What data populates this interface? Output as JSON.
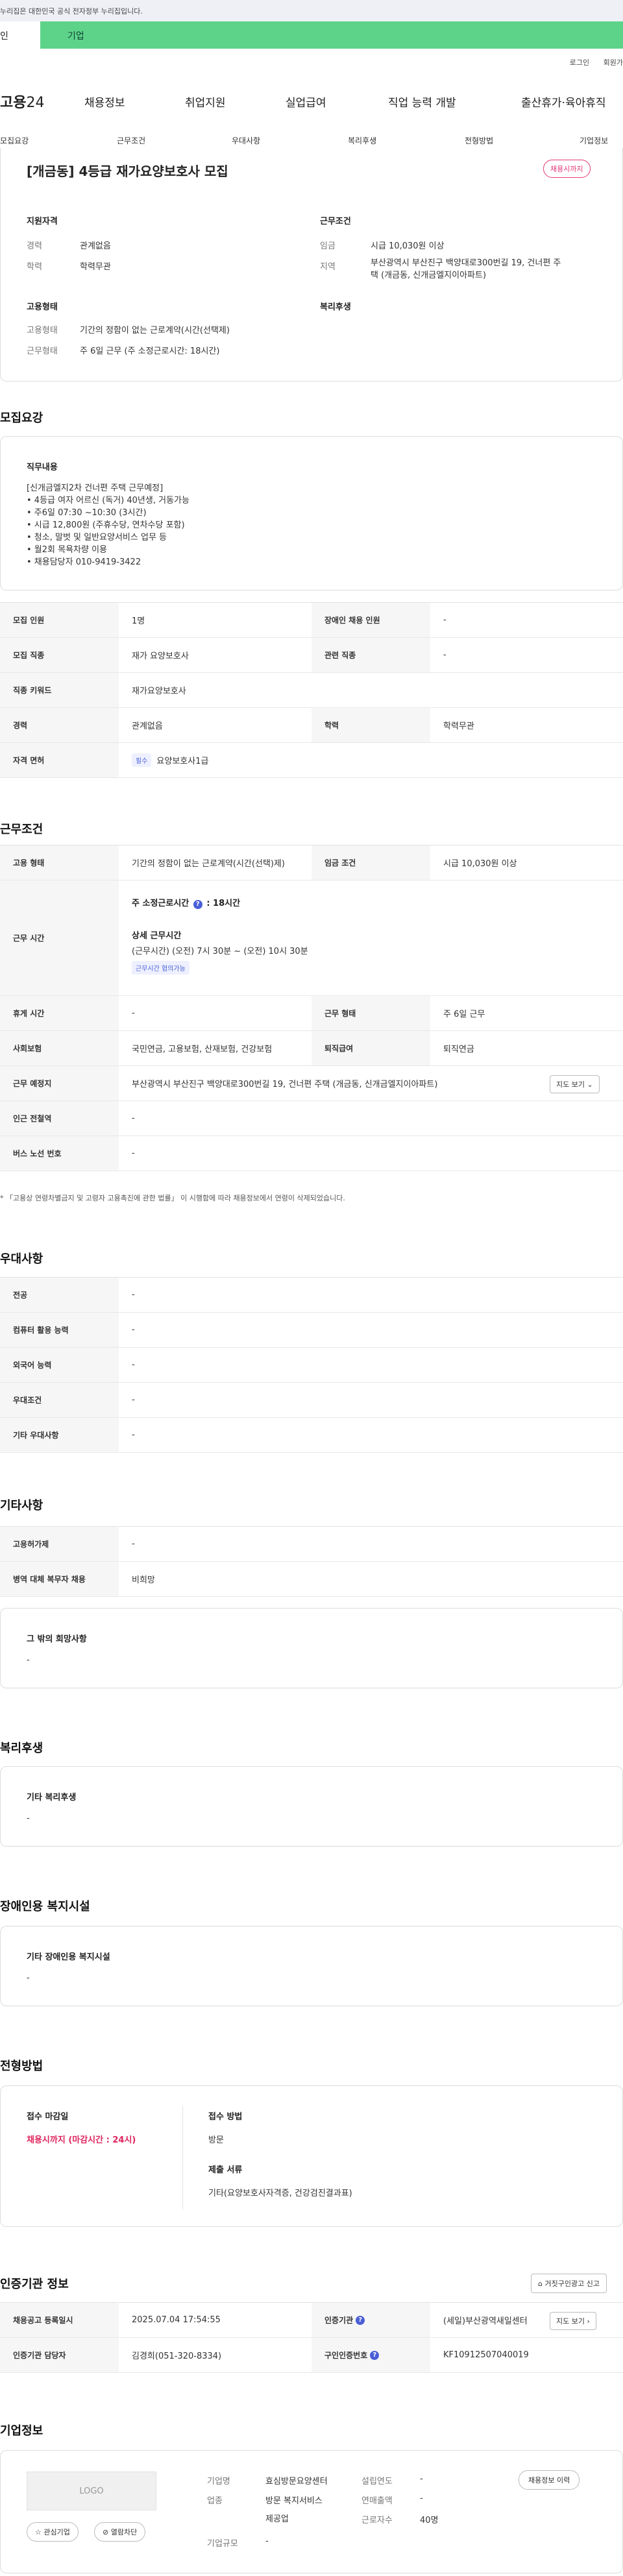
{
  "banner": {
    "text": "누리집은 대한민국 공식 전자정부 누리집입니다."
  },
  "tabs": {
    "personal": "인",
    "company": "기업"
  },
  "util": {
    "login": "로그인",
    "join": "회원가"
  },
  "gnb": {
    "logo_text": "고용",
    "logo_num": "24",
    "menu": [
      "채용정보",
      "취업지원",
      "실업급여",
      "직업 능력 개발",
      "출산휴가·육아휴직"
    ]
  },
  "subnav": [
    "모집요강",
    "근무조건",
    "우대사항",
    "복리후생",
    "전형방법",
    "기업정보"
  ],
  "summary": {
    "title": "[개금동] 4등급 재가요양보호사 모집",
    "status_badge": "채용시까지",
    "qual_heading": "지원자격",
    "career_label": "경력",
    "career_value": "관계없음",
    "edu_label": "학력",
    "edu_value": "학력무관",
    "work_heading": "근무조건",
    "wage_label": "임금",
    "wage_value": "시급 10,030원 이상",
    "area_label": "지역",
    "area_value_1": "부산광역시 부산진구 백양대로300번길 19, 건너편 주",
    "area_value_2": "택 (개금동, 신개금엘지이아파트)",
    "emp_heading": "고용형태",
    "emptype_label": "고용형태",
    "emptype_value": "기간의 정함이 없는 근로계약(시간(선택제)",
    "workform_label": "근무형태",
    "workform_value": "주 6일 근무 (주 소정근로시간: 18시간)",
    "welfare_heading": "복리후생"
  },
  "recruit": {
    "section_title": "모집요강",
    "job_desc_heading": "직무내용",
    "job_desc_lines": [
      "[신개금엘지2차 건너편 주택 근무예정]",
      "• 4등급 여자 어르신 (독거) 40년생, 거동가능",
      "• 주6일 07:30 ~10:30 (3시간)",
      "• 시급 12,800원 (주휴수당, 연차수당 포함)",
      "• 청소, 말벗 및 일반요양서비스 업무 등",
      "• 월2회 목욕차량 이용",
      "• 채용담당자 010-9419-3422"
    ],
    "rows": [
      {
        "k1": "모집 인원",
        "v1": "1명",
        "k2": "장애인 채용 인원",
        "v2": "-"
      },
      {
        "k1": "모집 직종",
        "v1": "재가 요양보호사",
        "k2": "관련 직종",
        "v2": "-"
      }
    ],
    "keyword_label": "직종 키워드",
    "keyword_value": "재가요양보호사",
    "career_label": "경력",
    "career_value": "관계없음",
    "edu_label": "학력",
    "edu_value": "학력무관",
    "license_label": "자격 면허",
    "license_chip": "필수",
    "license_value": "요양보호사1급"
  },
  "conditions": {
    "section_title": "근무조건",
    "emptype_label": "고용 형태",
    "emptype_value": "기간의 정함이 없는 근로계약(시간(선택)제)",
    "wage_label": "임금 조건",
    "wage_value": "시급 10,030원 이상",
    "worktime_label": "근무 시간",
    "weekly_hours_title": "주 소정근로시간",
    "weekly_hours_value": ": 18시간",
    "detail_title": "상세 근무시간",
    "detail_value": "(근무시간) (오전) 7시 30분 ~ (오전) 10시 30분",
    "flex_chip": "근무시간 협의가능",
    "holiday_label": "휴게 시간",
    "holiday_value": "-",
    "workform_label": "근무 형태",
    "workform_value": "주 6일 근무",
    "insurance_label": "사회보험",
    "insurance_value": "국민연금, 고용보험, 산재보험, 건강보험",
    "pension_label": "퇴직급여",
    "pension_value": "퇴직연금",
    "location_label": "근무 예정지",
    "location_value": "부산광역시 부산진구 백양대로300번길 19, 건너편 주택 (개금동, 신개금엘지이아파트)",
    "map_button": "지도 보기",
    "subway_label": "인근 전철역",
    "subway_value": "-",
    "bus_label": "버스 노선 번호",
    "bus_value": "-",
    "note": "* 「고용상 연령차별금지 및 고령자 고용촉진에 관한 법률」 이 시행함에 따라 채용정보에서 연령이 삭제되었습니다."
  },
  "preference": {
    "section_title": "우대사항",
    "rows": [
      {
        "k": "전공",
        "v": "-"
      },
      {
        "k": "컴퓨터 활용 능력",
        "v": "-"
      },
      {
        "k": "외국어 능력",
        "v": "-"
      },
      {
        "k": "우대조건",
        "v": "-"
      },
      {
        "k": "기타 우대사항",
        "v": "-"
      }
    ]
  },
  "other": {
    "section_title": "기타사항",
    "rows": [
      {
        "k": "고용허가제",
        "v": "-"
      },
      {
        "k": "병역 대체 복무자 채용",
        "v": "비희망"
      }
    ],
    "box_title": "그 밖의 희망사항",
    "box_value": "-"
  },
  "welfare": {
    "section_title": "복리후생",
    "box_title": "기타 복리후생",
    "box_value": "-"
  },
  "disability": {
    "section_title": "장애인용 복지시설",
    "box_title": "기타 장애인용 복지시설",
    "box_value": "-"
  },
  "selection": {
    "section_title": "전형방법",
    "deadline_title": "접수 마감일",
    "deadline_value": "채용시까지 (마감시간 : 24시)",
    "method_title": "접수 방법",
    "method_value": "방문",
    "docs_title": "제출 서류",
    "docs_value": "기타(요양보호사자격증, 건강검진결과표)"
  },
  "agency": {
    "section_title": "인증기관 정보",
    "report_button": "거짓구인광고 신고",
    "reg_date_label": "채용공고 등록일시",
    "reg_date_value": "2025.07.04 17:54:55",
    "agency_label": "인증기관",
    "agency_value": "(세일)부산광역새일센터",
    "map_button": "지도 보기",
    "manager_label": "인증기관 담당자",
    "manager_value": "김경희(051-320-8334)",
    "reqno_label": "구인인증번호",
    "reqno_value": "KF10912507040019"
  },
  "company": {
    "section_title": "기업정보",
    "logo_placeholder": "LOGO",
    "fav_button": "관심기업",
    "block_button": "열람차단",
    "name_label": "기업명",
    "name_value": "효심방문요양센터",
    "industry_label": "업종",
    "industry_value_1": "방문 복지서비스",
    "industry_value_2": "제공업",
    "size_label": "기업규모",
    "size_value": "-",
    "founded_label": "설립연도",
    "founded_value": "-",
    "sales_label": "연매출액",
    "sales_value": "-",
    "staff_label": "근로자수",
    "staff_value": "40명",
    "history_button": "채용정보 이력"
  },
  "colors": {
    "brand_green": "#5dd38a",
    "badge_red": "#e5397a",
    "chip_blue": "#4a5fd6",
    "deadline_red": "#e0245e"
  }
}
